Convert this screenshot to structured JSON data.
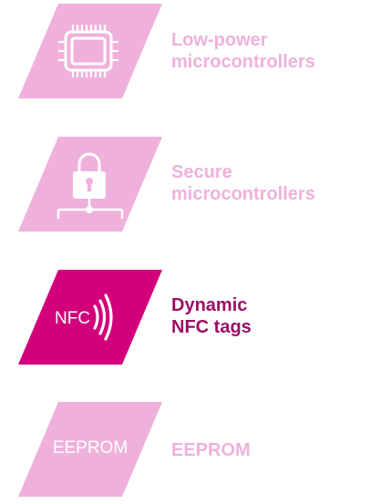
{
  "colors": {
    "inactive_tile": "#efb1dc",
    "active_tile": "#d3007b",
    "inactive_text": "#efb1dc",
    "active_text": "#9b0f66",
    "icon_white": "#ffffff"
  },
  "items": [
    {
      "label_line1": "Low-power",
      "label_line2": "microcontrollers",
      "icon": "chip-icon",
      "active": false
    },
    {
      "label_line1": "Secure",
      "label_line2": "microcontrollers",
      "icon": "lock-network-icon",
      "active": false
    },
    {
      "label_line1": "Dynamic",
      "label_line2": "NFC tags",
      "icon": "nfc-icon",
      "icon_text": "NFC",
      "active": true
    },
    {
      "label_line1": "EEPROM",
      "icon": "eeprom-icon",
      "icon_text": "EEPROM",
      "active": false
    }
  ]
}
